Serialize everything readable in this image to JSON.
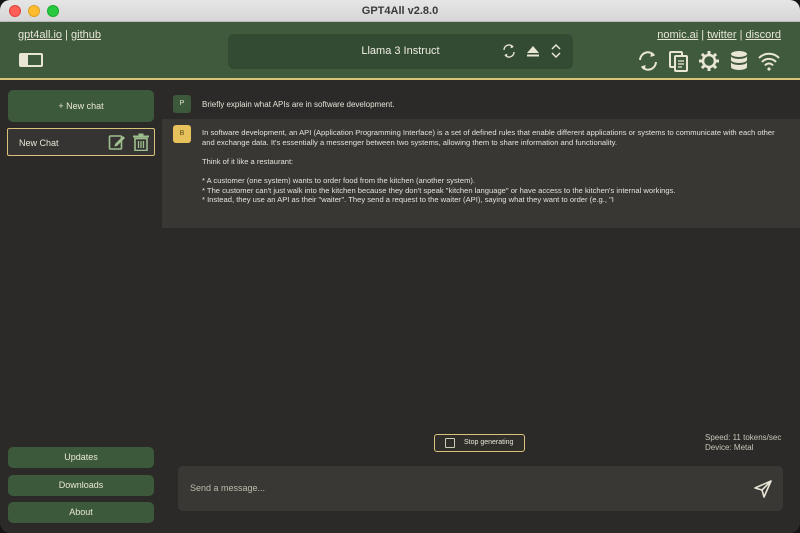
{
  "window": {
    "title": "GPT4All v2.8.0"
  },
  "header": {
    "left_links": [
      "gpt4all.io",
      "github"
    ],
    "right_links": [
      "nomic.ai",
      "twitter",
      "discord"
    ],
    "model_name": "Llama 3 Instruct",
    "icons": [
      "sidebar-toggle-icon",
      "reload-icon",
      "eject-icon",
      "chevron-updown-icon",
      "refresh-icon",
      "copy-icon",
      "gear-icon",
      "database-icon",
      "wifi-icon"
    ]
  },
  "sidebar": {
    "new_chat_label": "+ New chat",
    "chat_item": "New Chat",
    "updates_label": "Updates",
    "downloads_label": "Downloads",
    "about_label": "About"
  },
  "conversation": {
    "user_avatar": "P",
    "prompt": "Briefly explain what APIs are in software development.",
    "bot_avatar": "B",
    "response_paragraphs": [
      "In software development, an API (Application Programming Interface) is a set of defined rules that enable different applications or systems to communicate with each other and exchange data. It's essentially a messenger between two systems, allowing them to share information and functionality.",
      "Think of it like a restaurant:"
    ],
    "response_bullets": [
      "* A customer (one system) wants to order food from the kitchen (another system).",
      "* The customer can't just walk into the kitchen because they don't speak \"kitchen language\" or have access to the kitchen's internal workings.",
      "* Instead, they use an API as their \"waiter\". They send a request to the waiter (API), saying what they want to order (e.g., \"I"
    ]
  },
  "footer": {
    "stop_label": "Stop generating",
    "speed": "Speed: 11 tokens/sec",
    "device": "Device: Metal",
    "input_placeholder": "Send a message..."
  },
  "colors": {
    "header": "#3f5a3d",
    "accent": "#d9c37a",
    "bot_avatar": "#e7c15b"
  }
}
